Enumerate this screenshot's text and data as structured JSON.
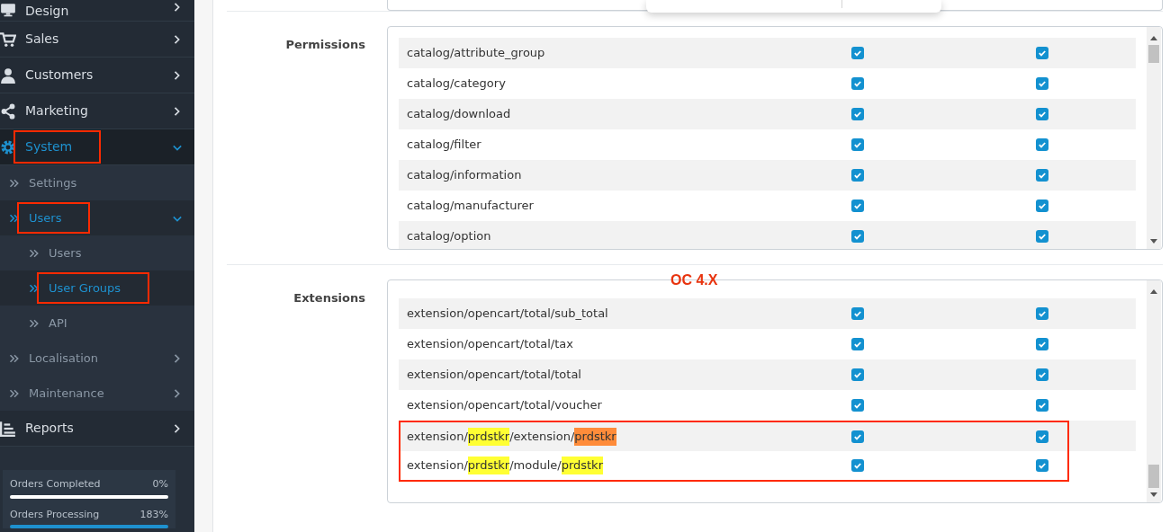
{
  "sidebar": {
    "items": [
      {
        "label": "Design",
        "kind": "menu",
        "selected": false,
        "expanded": false,
        "annotated": false
      },
      {
        "label": "Sales",
        "kind": "menu",
        "selected": false,
        "expanded": false,
        "annotated": false
      },
      {
        "label": "Customers",
        "kind": "menu",
        "selected": false,
        "expanded": false,
        "annotated": false
      },
      {
        "label": "Marketing",
        "kind": "menu",
        "selected": false,
        "expanded": false,
        "annotated": false
      },
      {
        "label": "System",
        "kind": "menu",
        "selected": true,
        "expanded": true,
        "annotated": true,
        "children": [
          {
            "label": "Settings",
            "kind": "link",
            "selected": false,
            "annotated": false
          },
          {
            "label": "Users",
            "kind": "menu",
            "selected": true,
            "expanded": true,
            "annotated": true,
            "children": [
              {
                "label": "Users",
                "kind": "link",
                "selected": false,
                "annotated": false
              },
              {
                "label": "User Groups",
                "kind": "link",
                "selected": true,
                "annotated": true
              },
              {
                "label": "API",
                "kind": "link",
                "selected": false,
                "annotated": false
              }
            ]
          },
          {
            "label": "Localisation",
            "kind": "menu",
            "selected": false,
            "expanded": false,
            "annotated": false
          },
          {
            "label": "Maintenance",
            "kind": "menu",
            "selected": false,
            "expanded": false,
            "annotated": false
          }
        ]
      },
      {
        "label": "Reports",
        "kind": "menu",
        "selected": false,
        "expanded": false,
        "annotated": false
      }
    ],
    "stats": [
      {
        "label": "Orders Completed",
        "value": "0%",
        "level": 0
      },
      {
        "label": "Orders Processing",
        "value": "183%",
        "level": 1
      }
    ]
  },
  "annotation": {
    "text": "OC 4.X"
  },
  "sections": [
    {
      "label": "Permissions",
      "rows": [
        {
          "segments": [
            {
              "text": "catalog/attribute_group"
            }
          ],
          "checks": [
            {
              "checked": true
            },
            {
              "checked": true
            }
          ],
          "annotated": false
        },
        {
          "segments": [
            {
              "text": "catalog/category"
            }
          ],
          "checks": [
            {
              "checked": true
            },
            {
              "checked": true
            }
          ],
          "annotated": false
        },
        {
          "segments": [
            {
              "text": "catalog/download"
            }
          ],
          "checks": [
            {
              "checked": true
            },
            {
              "checked": true
            }
          ],
          "annotated": false
        },
        {
          "segments": [
            {
              "text": "catalog/filter"
            }
          ],
          "checks": [
            {
              "checked": true
            },
            {
              "checked": true
            }
          ],
          "annotated": false
        },
        {
          "segments": [
            {
              "text": "catalog/information"
            }
          ],
          "checks": [
            {
              "checked": true
            },
            {
              "checked": true
            }
          ],
          "annotated": false
        },
        {
          "segments": [
            {
              "text": "catalog/manufacturer"
            }
          ],
          "checks": [
            {
              "checked": true
            },
            {
              "checked": true
            }
          ],
          "annotated": false
        },
        {
          "segments": [
            {
              "text": "catalog/option"
            }
          ],
          "checks": [
            {
              "checked": true
            },
            {
              "checked": true
            }
          ],
          "annotated": false
        }
      ]
    },
    {
      "label": "Extensions",
      "rows": [
        {
          "segments": [
            {
              "text": "extension/opencart/total/sub_total"
            }
          ],
          "checks": [
            {
              "checked": true
            },
            {
              "checked": true
            }
          ],
          "annotated": false
        },
        {
          "segments": [
            {
              "text": "extension/opencart/total/tax"
            }
          ],
          "checks": [
            {
              "checked": true
            },
            {
              "checked": true
            }
          ],
          "annotated": false
        },
        {
          "segments": [
            {
              "text": "extension/opencart/total/total"
            }
          ],
          "checks": [
            {
              "checked": true
            },
            {
              "checked": true
            }
          ],
          "annotated": false
        },
        {
          "segments": [
            {
              "text": "extension/opencart/total/voucher"
            }
          ],
          "checks": [
            {
              "checked": true
            },
            {
              "checked": true
            }
          ],
          "annotated": false
        },
        {
          "segments": [
            {
              "text": "extension/"
            },
            {
              "text": "prdstkr",
              "color": "#ffff33"
            },
            {
              "text": "/extension/"
            },
            {
              "text": "prdstkr",
              "color": "#ff8c3a"
            }
          ],
          "checks": [
            {
              "checked": true
            },
            {
              "checked": true
            }
          ],
          "annotated": true
        },
        {
          "segments": [
            {
              "text": "extension/"
            },
            {
              "text": "prdstkr",
              "color": "#ffff33"
            },
            {
              "text": "/module/"
            },
            {
              "text": "prdstkr",
              "color": "#ffff33"
            }
          ],
          "checks": [
            {
              "checked": true
            },
            {
              "checked": true
            }
          ],
          "annotated": true
        }
      ]
    }
  ]
}
